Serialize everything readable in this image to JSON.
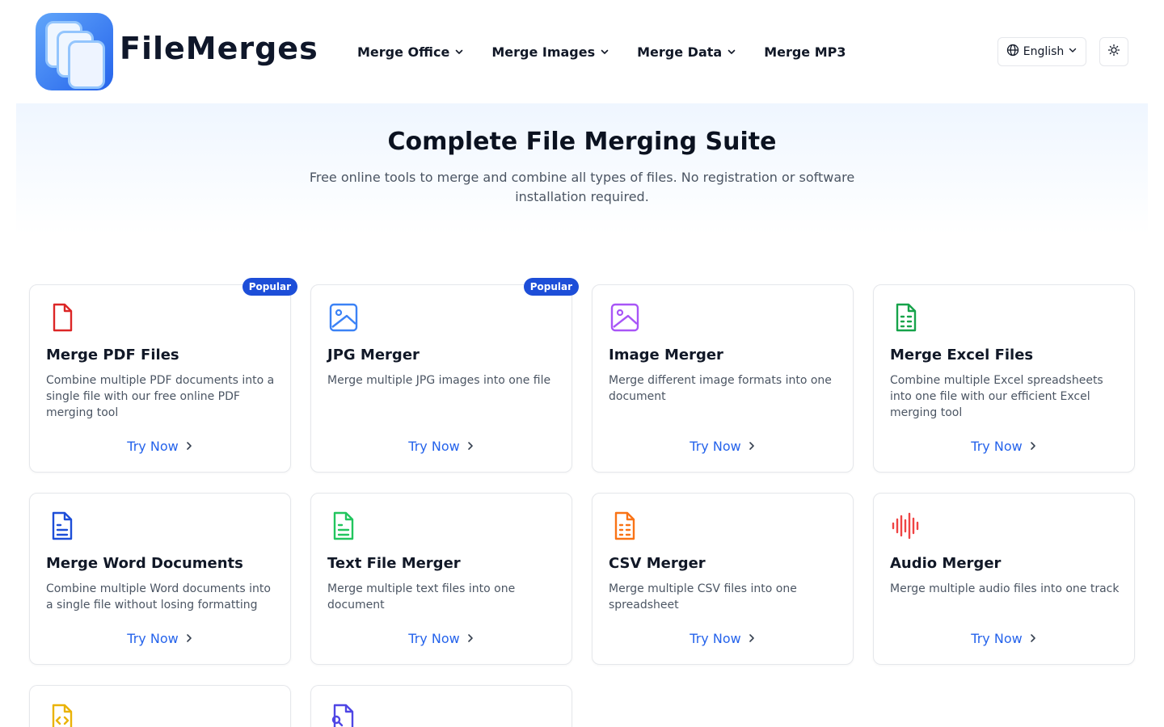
{
  "header": {
    "brand": "FileMerges",
    "nav": [
      {
        "label": "Merge Office",
        "dropdown": true
      },
      {
        "label": "Merge Images",
        "dropdown": true
      },
      {
        "label": "Merge Data",
        "dropdown": true
      },
      {
        "label": "Merge MP3",
        "dropdown": false
      }
    ],
    "language": "English",
    "theme_icon": "sun-icon"
  },
  "hero": {
    "title": "Complete File Merging Suite",
    "subtitle": "Free online tools to merge and combine all types of files. No registration or software installation required."
  },
  "colors": {
    "accent": "#2563eb",
    "badge": "#1d4ed8",
    "pdf": "#dc2626",
    "jpg": "#3b82f6",
    "image": "#a855f7",
    "excel": "#16a34a",
    "word": "#1d4ed8",
    "text": "#22c55e",
    "csv": "#f97316",
    "audio": "#ef4444",
    "code": "#eab308",
    "search": "#4f46e5"
  },
  "cards": [
    {
      "title": "Merge PDF Files",
      "desc": "Combine multiple PDF documents into a single file with our free online PDF merging tool",
      "cta": "Try Now",
      "badge": "Popular",
      "icon": "pdf-file-icon"
    },
    {
      "title": "JPG Merger",
      "desc": "Merge multiple JPG images into one file",
      "cta": "Try Now",
      "badge": "Popular",
      "icon": "image-icon"
    },
    {
      "title": "Image Merger",
      "desc": "Merge different image formats into one document",
      "cta": "Try Now",
      "badge": "",
      "icon": "image-icon"
    },
    {
      "title": "Merge Excel Files",
      "desc": "Combine multiple Excel spreadsheets into one file with our efficient Excel merging tool",
      "cta": "Try Now",
      "badge": "",
      "icon": "spreadsheet-icon"
    },
    {
      "title": "Merge Word Documents",
      "desc": "Combine multiple Word documents into a single file without losing formatting",
      "cta": "Try Now",
      "badge": "",
      "icon": "document-icon"
    },
    {
      "title": "Text File Merger",
      "desc": "Merge multiple text files into one document",
      "cta": "Try Now",
      "badge": "",
      "icon": "text-file-icon"
    },
    {
      "title": "CSV Merger",
      "desc": "Merge multiple CSV files into one spreadsheet",
      "cta": "Try Now",
      "badge": "",
      "icon": "csv-file-icon"
    },
    {
      "title": "Audio Merger",
      "desc": "Merge multiple audio files into one track",
      "cta": "Try Now",
      "badge": "",
      "icon": "audio-waveform-icon"
    },
    {
      "title": "",
      "desc": "",
      "cta": "",
      "badge": "",
      "icon": "code-file-icon"
    },
    {
      "title": "",
      "desc": "",
      "cta": "",
      "badge": "",
      "icon": "file-search-icon"
    }
  ]
}
